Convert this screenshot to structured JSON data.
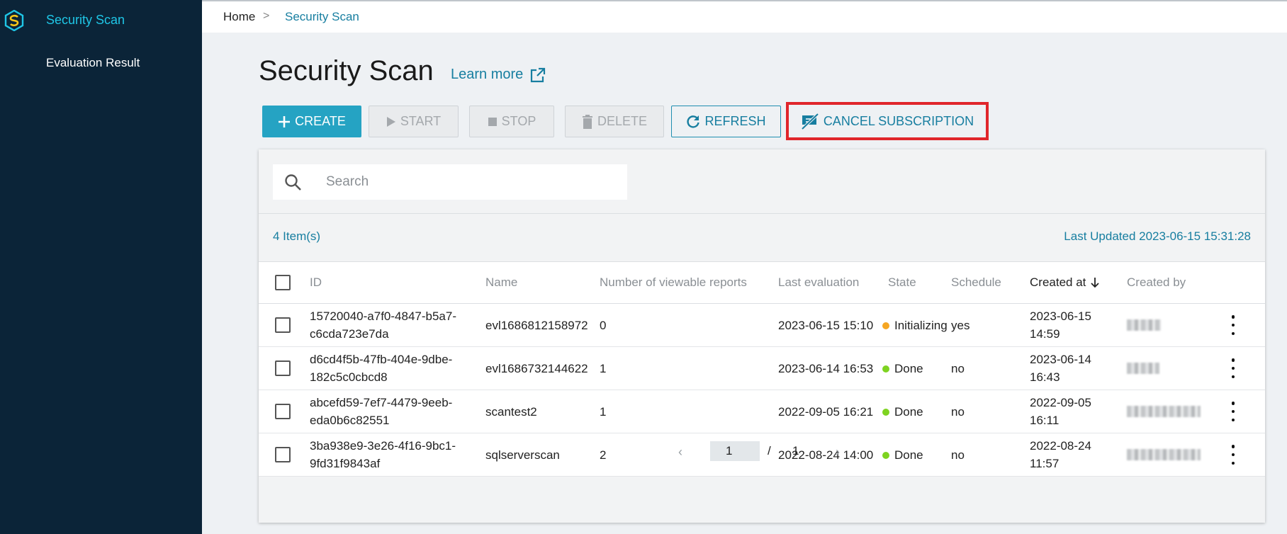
{
  "sidebar": {
    "active_item": "Security Scan",
    "items": [
      "Evaluation Result"
    ]
  },
  "breadcrumb": {
    "home": "Home",
    "separator": ">",
    "current": "Security Scan"
  },
  "page": {
    "title": "Security Scan",
    "learn_more": "Learn more"
  },
  "toolbar": {
    "create": "CREATE",
    "start": "START",
    "stop": "STOP",
    "delete": "DELETE",
    "refresh": "REFRESH",
    "cancel_subscription": "CANCEL SUBSCRIPTION"
  },
  "search": {
    "placeholder": "Search",
    "value": ""
  },
  "summary": {
    "item_count": "4 Item(s)",
    "last_updated": "Last Updated 2023-06-15 15:31:28"
  },
  "table": {
    "headers": {
      "id": "ID",
      "name": "Name",
      "reports": "Number of viewable reports",
      "last_eval": "Last evaluation",
      "state": "State",
      "schedule": "Schedule",
      "created_at": "Created at",
      "created_by": "Created by"
    },
    "rows": [
      {
        "id_line1": "15720040-a7f0-4847-b5a7-",
        "id_line2": "c6cda723e7da",
        "name": "evl1686812158972",
        "reports": "0",
        "last_eval": "2023-06-15 15:10",
        "state": "Initializing",
        "state_color": "#f5a623",
        "schedule": "yes",
        "created_line1": "2023-06-15",
        "created_line2": "14:59"
      },
      {
        "id_line1": "d6cd4f5b-47fb-404e-9dbe-",
        "id_line2": "182c5c0cbcd8",
        "name": "evl1686732144622",
        "reports": "1",
        "last_eval": "2023-06-14 16:53",
        "state": "Done",
        "state_color": "#7ed321",
        "schedule": "no",
        "created_line1": "2023-06-14",
        "created_line2": "16:43"
      },
      {
        "id_line1": "abcefd59-7ef7-4479-9eeb-",
        "id_line2": "eda0b6c82551",
        "name": "scantest2",
        "reports": "1",
        "last_eval": "2022-09-05 16:21",
        "state": "Done",
        "state_color": "#7ed321",
        "schedule": "no",
        "created_line1": "2022-09-05",
        "created_line2": "16:11"
      },
      {
        "id_line1": "3ba938e9-3e26-4f16-9bc1-",
        "id_line2": "9fd31f9843af",
        "name": "sqlserverscan",
        "reports": "2",
        "last_eval": "2022-08-24 14:00",
        "state": "Done",
        "state_color": "#7ed321",
        "schedule": "no",
        "created_line1": "2022-08-24",
        "created_line2": "11:57"
      }
    ]
  },
  "pagination": {
    "current": "1",
    "separator": "/",
    "total": "1",
    "prev": "‹",
    "next": "›"
  },
  "colors": {
    "sidebar_bg": "#0b2438",
    "accent": "#25a3c3",
    "link": "#177ea0",
    "highlight": "#e0262b"
  },
  "icons": [
    "app-logo-icon",
    "plus-icon",
    "play-icon",
    "stop-icon",
    "trash-icon",
    "refresh-icon",
    "no-subscription-icon",
    "external-link-icon",
    "search-icon",
    "sort-down-arrow-icon",
    "kebab-menu-icon"
  ]
}
